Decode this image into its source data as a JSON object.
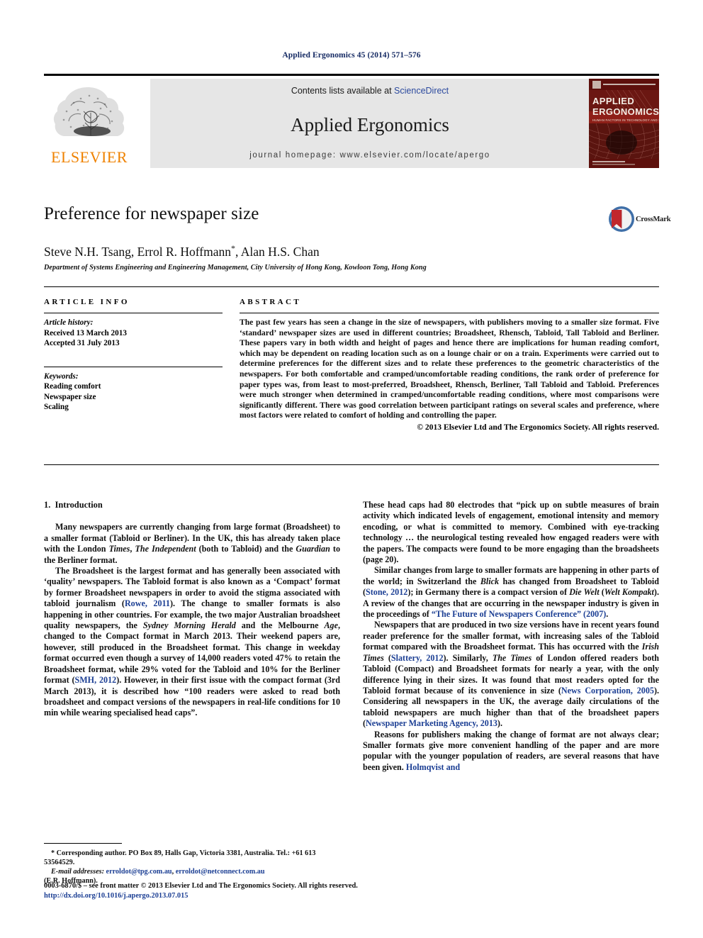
{
  "running_head": "Applied Ergonomics 45 (2014) 571–576",
  "masthead": {
    "contents_prefix": "Contents lists available at",
    "sciencedirect": "ScienceDirect",
    "journal_name": "Applied Ergonomics",
    "homepage": "journal homepage: www.elsevier.com/locate/apergo",
    "publisher_logo": "ELSEVIER",
    "cover_line1": "APPLIED",
    "cover_line2": "ERGONOMICS",
    "cover_sub": "HUMAN FACTORS IN TECHNOLOGY AND SOCIETY",
    "link_color": "#2c4a9e",
    "band_color": "#e6e6e6",
    "elsevier_orange": "#ef8200",
    "cover_red": "#7d1a16"
  },
  "article": {
    "title": "Preference for newspaper size",
    "authors": "Steve N.H. Tsang, Errol R. Hoffmann",
    "authors_tail": ", Alan H.S. Chan",
    "corresponding_mark": "*",
    "affiliation": "Department of Systems Engineering and Engineering Management, City University of Hong Kong, Kowloon Tong, Hong Kong",
    "crossmark_label": "CrossMark"
  },
  "info": {
    "heading": "ARTICLE INFO",
    "history_label": "Article history:",
    "received": "Received 13 March 2013",
    "accepted": "Accepted 31 July 2013",
    "keywords_label": "Keywords:",
    "keywords": [
      "Reading comfort",
      "Newspaper size",
      "Scaling"
    ]
  },
  "abstract": {
    "heading": "ABSTRACT",
    "text": "The past few years has seen a change in the size of newspapers, with publishers moving to a smaller size format. Five ‘standard’ newspaper sizes are used in different countries; Broadsheet, Rhensch, Tabloid, Tall Tabloid and Berliner. These papers vary in both width and height of pages and hence there are implications for human reading comfort, which may be dependent on reading location such as on a lounge chair or on a train. Experiments were carried out to determine preferences for the different sizes and to relate these preferences to the geometric characteristics of the newspapers. For both comfortable and cramped/uncomfortable reading conditions, the rank order of preference for paper types was, from least to most-preferred, Broadsheet, Rhensch, Berliner, Tall Tabloid and Tabloid. Preferences were much stronger when determined in cramped/uncomfortable reading conditions, where most comparisons were significantly different. There was good correlation between participant ratings on several scales and preference, where most factors were related to comfort of holding and controlling the paper.",
    "copyright": "© 2013 Elsevier Ltd and The Ergonomics Society. All rights reserved."
  },
  "body": {
    "section_number": "1.",
    "section_title": "Introduction",
    "left_paragraphs": [
      "Many newspapers are currently changing from large format (Broadsheet) to a smaller format (Tabloid or Berliner). In the UK, this has already taken place with the London Times, The Independent (both to Tabloid) and the Guardian to the Berliner format.",
      "The Broadsheet is the largest format and has generally been associated with ‘quality’ newspapers. The Tabloid format is also known as a ‘Compact’ format by former Broadsheet newspapers in order to avoid the stigma associated with tabloid journalism (Rowe, 2011). The change to smaller formats is also happening in other countries. For example, the two major Australian broadsheet quality newspapers, the Sydney Morning Herald and the Melbourne Age, changed to the Compact format in March 2013. Their weekend papers are, however, still produced in the Broadsheet format. This change in weekday format occurred even though a survey of 14,000 readers voted 47% to retain the Broadsheet format, while 29% voted for the Tabloid and 10% for the Berliner format (SMH, 2012). However, in their first issue with the compact format (3rd March 2013), it is described how “100 readers were asked to read both broadsheet and compact versions of the newspapers in real-life conditions for 10 min while wearing specialised head caps”."
    ],
    "right_paragraphs": [
      "These head caps had 80 electrodes that “pick up on subtle measures of brain activity which indicated levels of engagement, emotional intensity and memory encoding, or what is committed to memory. Combined with eye-tracking technology … the neurological testing revealed how engaged readers were with the papers. The compacts were found to be more engaging than the broadsheets (page 20).",
      "Similar changes from large to smaller formats are happening in other parts of the world; in Switzerland the Blick has changed from Broadsheet to Tabloid (Stone, 2012); in Germany there is a compact version of Die Welt (Welt Kompakt). A review of the changes that are occurring in the newspaper industry is given in the proceedings of “The Future of Newspapers Conference” (2007).",
      "Newspapers that are produced in two size versions have in recent years found reader preference for the smaller format, with increasing sales of the Tabloid format compared with the Broadsheet format. This has occurred with the Irish Times (Slattery, 2012). Similarly, The Times of London offered readers both Tabloid (Compact) and Broadsheet formats for nearly a year, with the only difference lying in their sizes. It was found that most readers opted for the Tabloid format because of its convenience in size (News Corporation, 2005). Considering all newspapers in the UK, the average daily circulations of the tabloid newspapers are much higher than that of the broadsheet papers (Newspaper Marketing Agency, 2013).",
      "Reasons for publishers making the change of format are not always clear; Smaller formats give more convenient handling of the paper and are more popular with the younger population of readers, are several reasons that have been given. Holmqvist and"
    ]
  },
  "footnote": {
    "corresponding": "* Corresponding author. PO Box 89, Halls Gap, Victoria 3381, Australia. Tel.: +61 613 53564529.",
    "email_label": "E-mail addresses:",
    "email1": "erroldot@tpg.com.au",
    "email2": "erroldot@netconnect.com.au",
    "email_owner": "(E.R. Hoffmann)."
  },
  "bottom": {
    "issn_line": "0003-6870/$ – see front matter © 2013 Elsevier Ltd and The Ergonomics Society. All rights reserved.",
    "doi": "http://dx.doi.org/10.1016/j.apergo.2013.07.015"
  }
}
